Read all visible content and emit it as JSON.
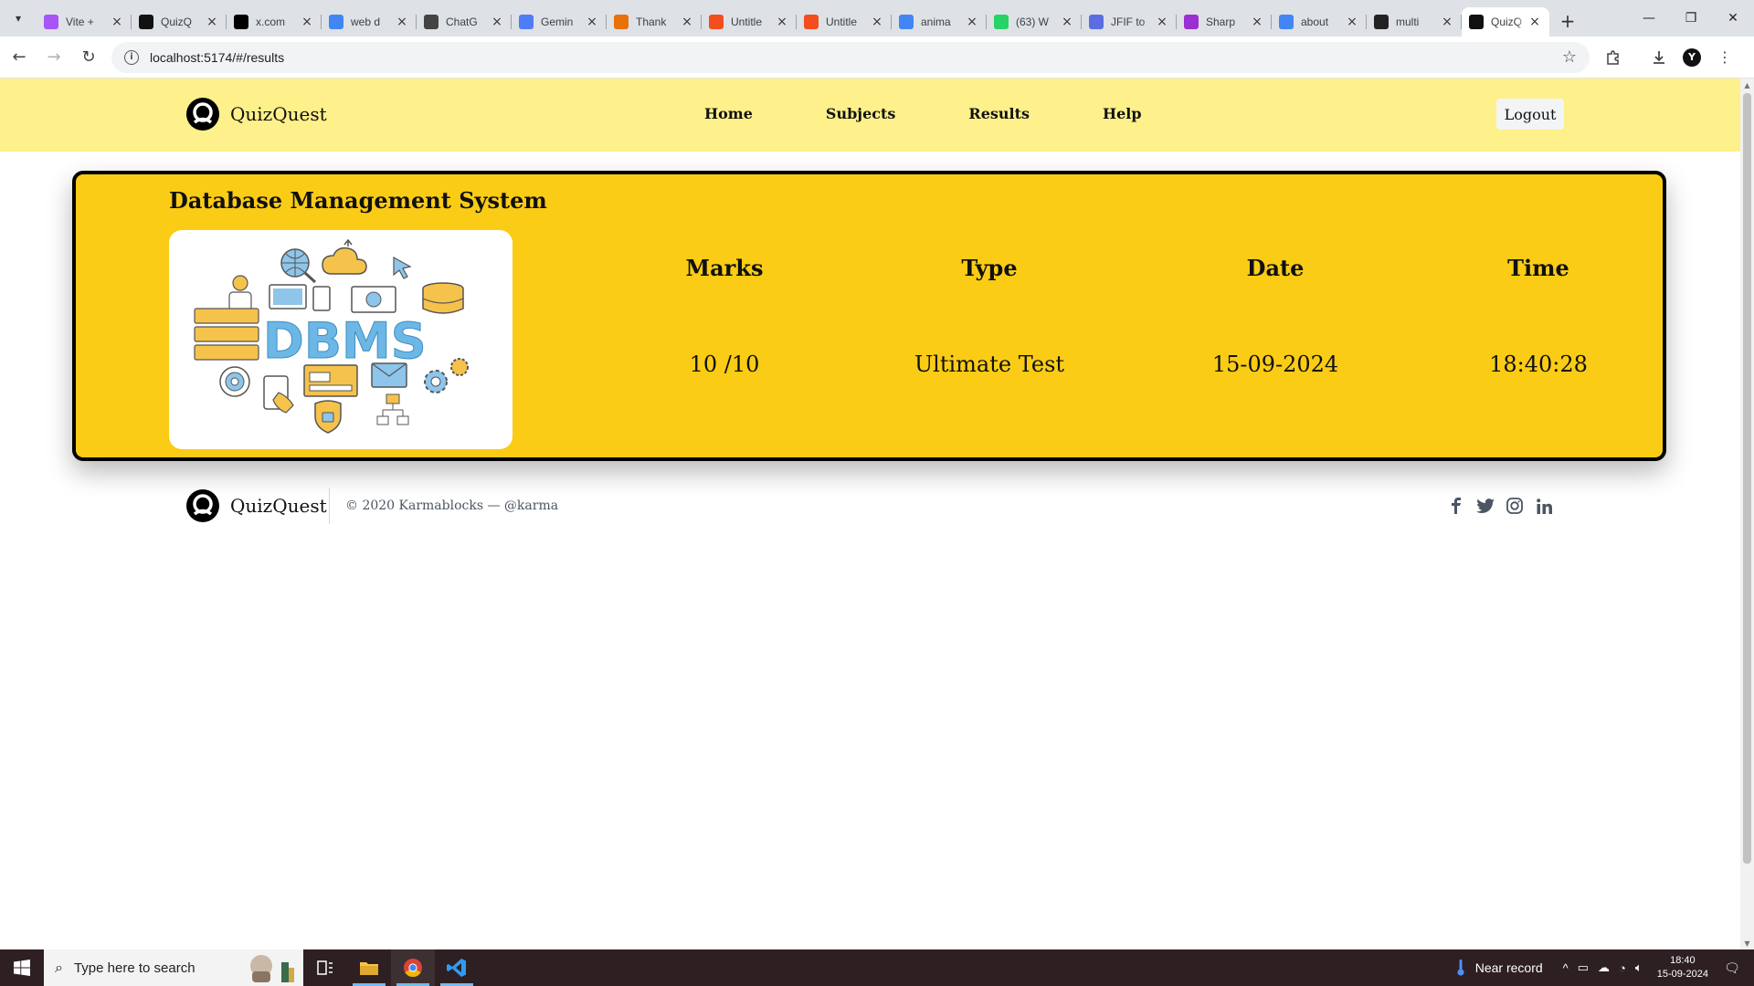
{
  "browser": {
    "tabs": [
      {
        "title": "Vite +",
        "favicon": "vite-icon",
        "color": "#a855f7"
      },
      {
        "title": "QuizQ",
        "favicon": "quizquest-icon",
        "color": "#111111"
      },
      {
        "title": "x.com",
        "favicon": "x-icon",
        "color": "#000000"
      },
      {
        "title": "web d",
        "favicon": "google-icon",
        "color": "#4285f4"
      },
      {
        "title": "ChatG",
        "favicon": "chatgpt-icon",
        "color": "#444444"
      },
      {
        "title": "Gemin",
        "favicon": "gemini-icon",
        "color": "#4f7cf7"
      },
      {
        "title": "Thank",
        "favicon": "thank-icon",
        "color": "#e8710a"
      },
      {
        "title": "Untitle",
        "favicon": "figma-icon",
        "color": "#f24e1e"
      },
      {
        "title": "Untitle",
        "favicon": "figma-icon",
        "color": "#f24e1e"
      },
      {
        "title": "anima",
        "favicon": "google-icon",
        "color": "#4285f4"
      },
      {
        "title": "(63) W",
        "favicon": "whatsapp-icon",
        "color": "#25d366"
      },
      {
        "title": "JFIF to",
        "favicon": "converter-icon",
        "color": "#5b6ee1"
      },
      {
        "title": "Sharp",
        "favicon": "sharp-icon",
        "color": "#9b2fd1"
      },
      {
        "title": "about",
        "favicon": "google-icon",
        "color": "#4285f4"
      },
      {
        "title": "multi",
        "favicon": "multi-icon",
        "color": "#222222"
      },
      {
        "title": "QuizQ",
        "favicon": "quizquest-icon",
        "color": "#111111",
        "active": true
      }
    ],
    "url": "localhost:5174/#/results"
  },
  "header": {
    "brand": "QuizQuest",
    "nav": [
      "Home",
      "Subjects",
      "Results",
      "Help"
    ],
    "logout": "Logout"
  },
  "result": {
    "subject": "Database Management System",
    "image_label": "DBMS",
    "columns": [
      {
        "heading": "Marks",
        "value": "10 /10"
      },
      {
        "heading": "Type",
        "value": "Ultimate Test"
      },
      {
        "heading": "Date",
        "value": "15-09-2024"
      },
      {
        "heading": "Time",
        "value": "18:40:28"
      }
    ]
  },
  "footer": {
    "brand": "QuizQuest",
    "copyright": "© 2020 Karmablocks — @karma",
    "socials": [
      "facebook-icon",
      "twitter-icon",
      "instagram-icon",
      "linkedin-icon"
    ]
  },
  "taskbar": {
    "search_placeholder": "Type here to search",
    "weather": "Near record",
    "time": "18:40",
    "date": "15-09-2024"
  },
  "colors": {
    "header_bg": "#fef08a",
    "card_bg": "#facc15",
    "taskbar_bg": "#2d1f22"
  }
}
